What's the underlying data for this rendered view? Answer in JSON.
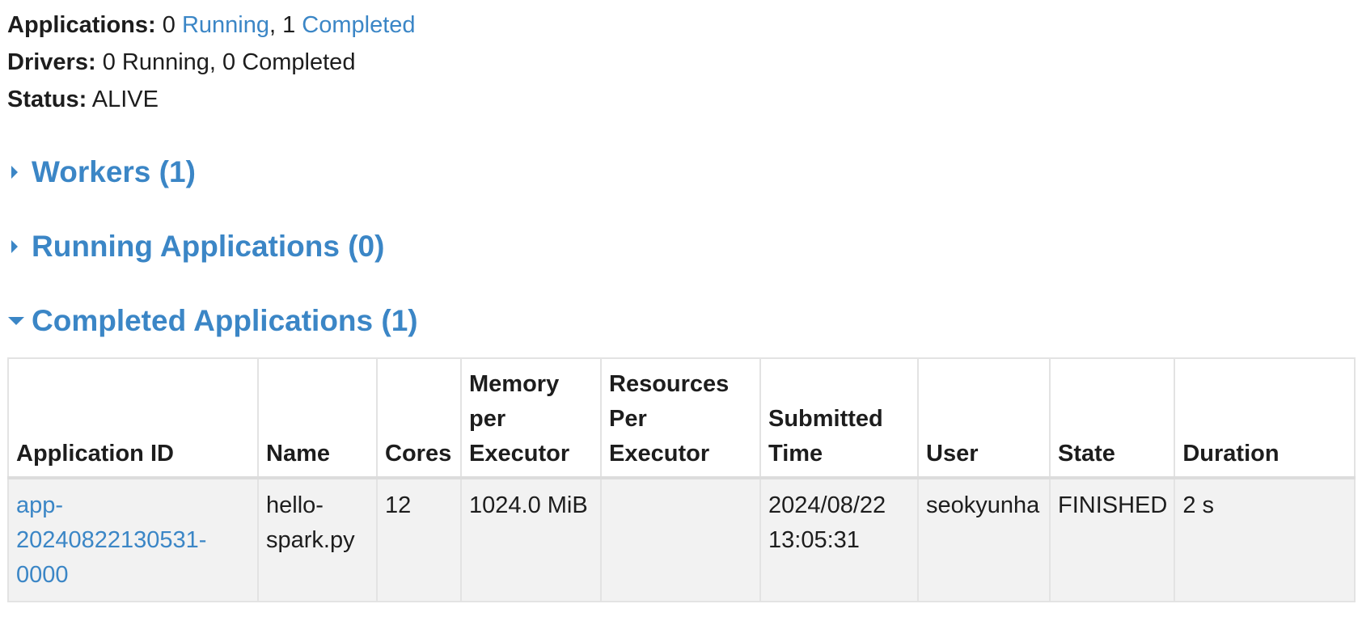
{
  "summary": {
    "applications": {
      "label": "Applications:",
      "running_count": "0",
      "running_label": "Running",
      "separator": ",",
      "completed_count": "1",
      "completed_label": "Completed"
    },
    "drivers": {
      "label": "Drivers:",
      "value": "0 Running, 0 Completed"
    },
    "status": {
      "label": "Status:",
      "value": "ALIVE"
    }
  },
  "sections": {
    "workers": {
      "title": "Workers (1)",
      "expanded": false
    },
    "running": {
      "title": "Running Applications (0)",
      "expanded": false
    },
    "completed": {
      "title": "Completed Applications (1)",
      "expanded": true
    }
  },
  "completed_table": {
    "headers": {
      "app_id": "Application ID",
      "name": "Name",
      "cores": "Cores",
      "memory": [
        "Memory",
        "per",
        "Executor"
      ],
      "resources": [
        "Resources",
        "Per",
        "Executor"
      ],
      "submitted": [
        "Submitted",
        "Time"
      ],
      "user": "User",
      "state": "State",
      "duration": "Duration"
    },
    "rows": [
      {
        "app_id": [
          "app-",
          "20240822130531-",
          "0000"
        ],
        "name": [
          "hello-",
          "spark.py"
        ],
        "cores": "12",
        "memory": "1024.0 MiB",
        "resources": "",
        "submitted": [
          "2024/08/22",
          "13:05:31"
        ],
        "user": "seokyunha",
        "state": "FINISHED",
        "duration": "2 s"
      }
    ]
  },
  "colors": {
    "link": "#3b86c6",
    "row_background": "#f2f2f2",
    "border": "#e3e3e3"
  },
  "icons": {
    "collapsed": "caret-right-icon",
    "expanded": "caret-down-icon"
  }
}
